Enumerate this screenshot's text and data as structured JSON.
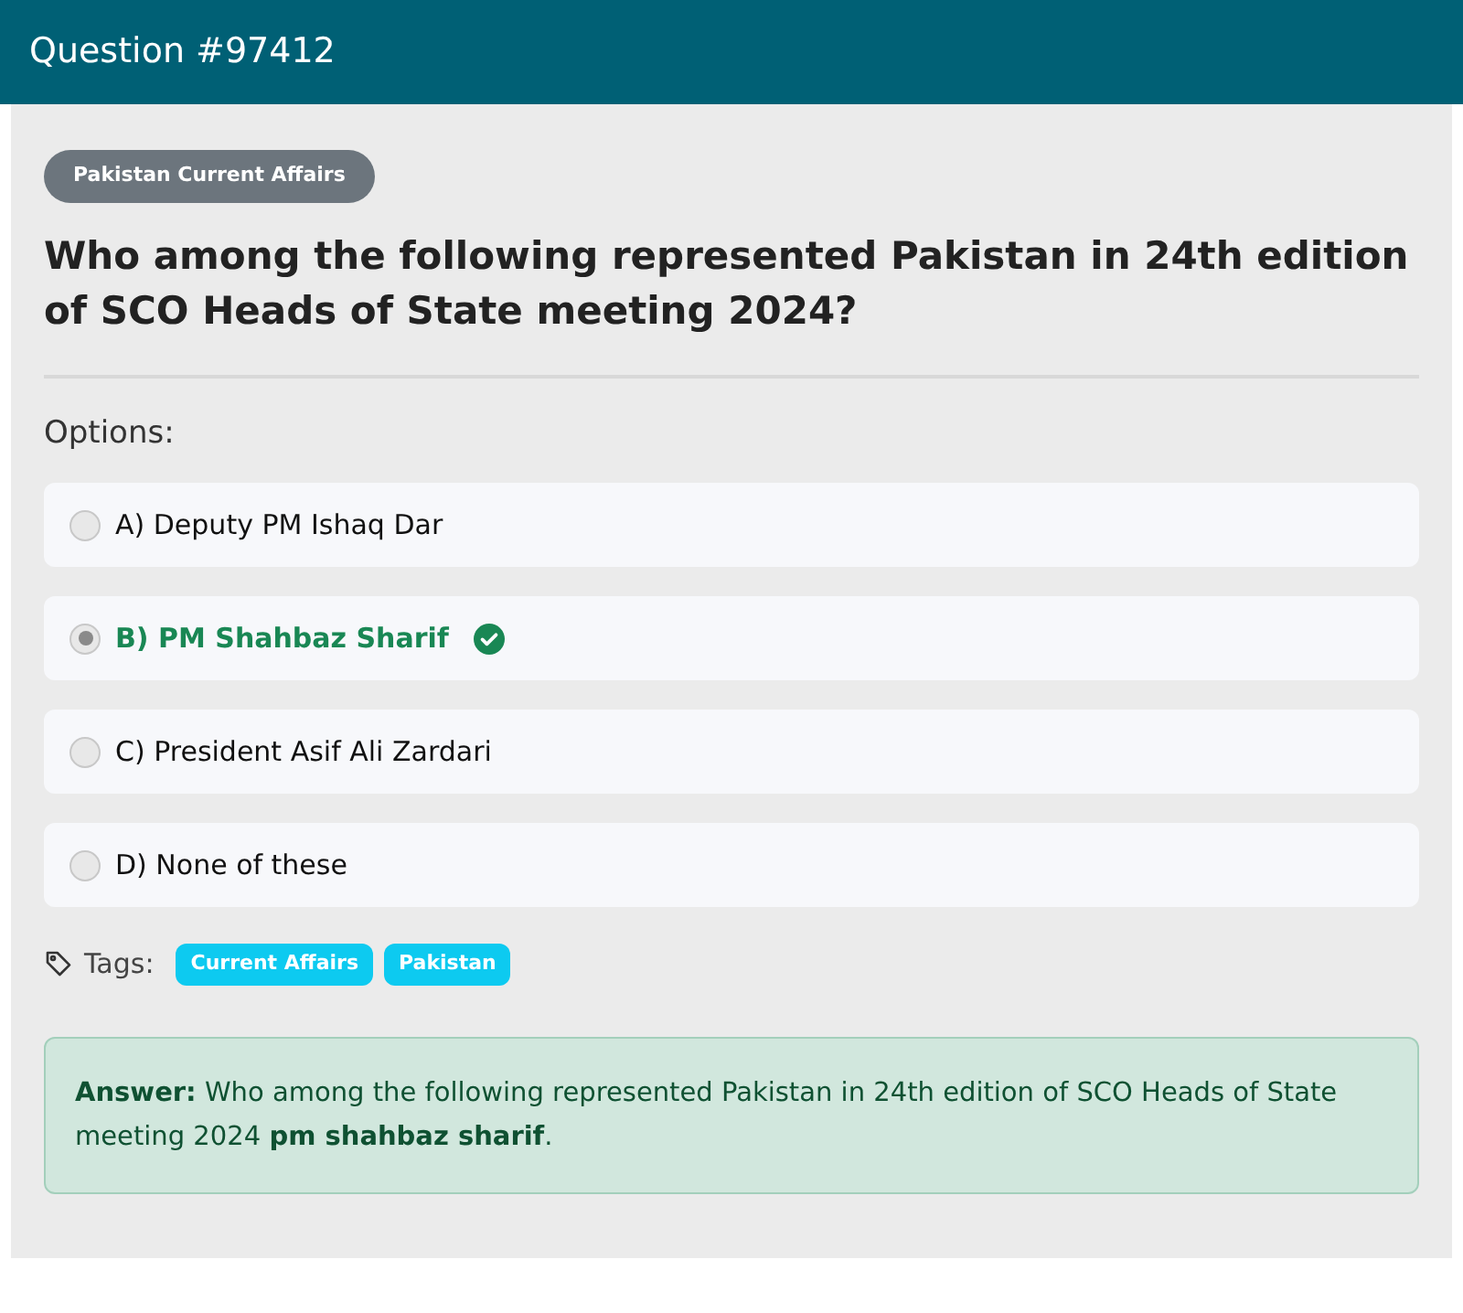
{
  "header": {
    "title": "Question #97412"
  },
  "category": "Pakistan Current Affairs",
  "question": "Who among the following represented Pakistan in 24th edition of SCO Heads of State meeting 2024?",
  "options_label": "Options:",
  "options": [
    {
      "label": "A) Deputy PM Ishaq Dar",
      "selected": false,
      "correct": false
    },
    {
      "label": "B) PM Shahbaz Sharif",
      "selected": true,
      "correct": true
    },
    {
      "label": "C) President Asif Ali Zardari",
      "selected": false,
      "correct": false
    },
    {
      "label": "D) None of these",
      "selected": false,
      "correct": false
    }
  ],
  "tags_label": "Tags:",
  "tags": [
    "Current Affairs",
    "Pakistan"
  ],
  "answer": "**Answer:** Who among the following represented Pakistan in 24th edition of SCO Heads of State meeting 2024 **pm shahbaz sharif**."
}
